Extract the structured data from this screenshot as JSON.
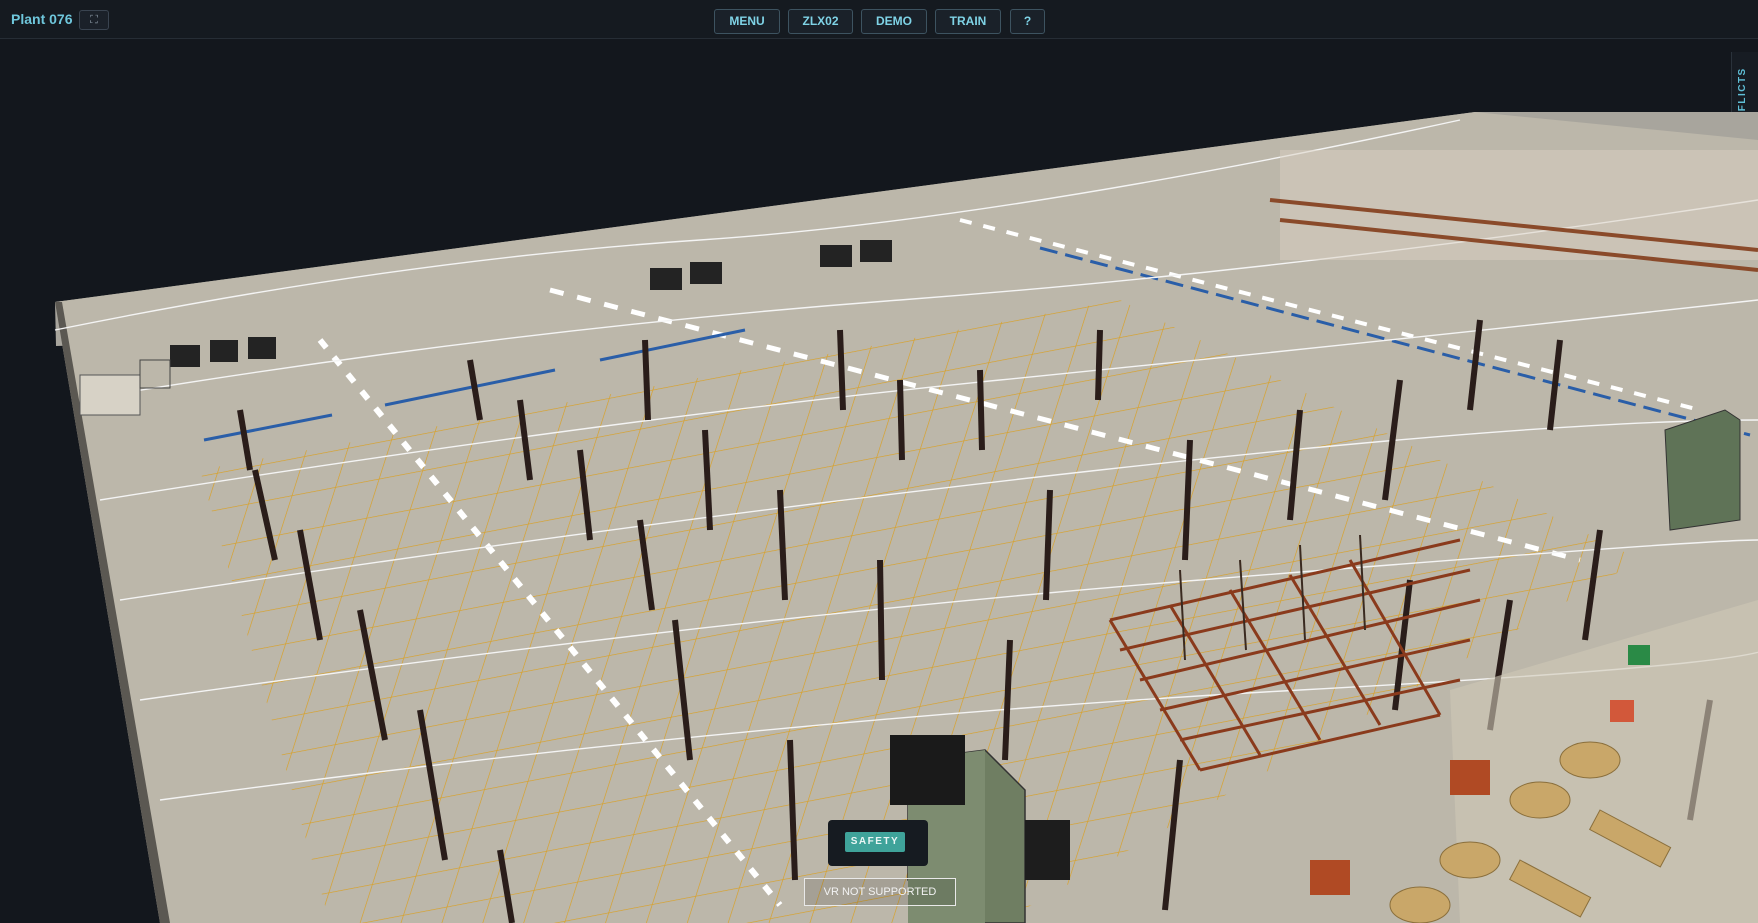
{
  "header": {
    "title": "Plant 076",
    "fullscreen_icon": "fullscreen-icon",
    "nav": [
      {
        "label": "MENU"
      },
      {
        "label": "ZLX02"
      },
      {
        "label": "DEMO"
      },
      {
        "label": "TRAIN"
      },
      {
        "label": "?"
      }
    ]
  },
  "side_panel": {
    "label": "CONFLICTS"
  },
  "scene": {
    "description_icon": "3d-warehouse-viewport"
  },
  "safety": {
    "label": "SAFETY"
  },
  "vr": {
    "label": "VR NOT SUPPORTED"
  },
  "colors": {
    "accent": "#6fc7dc",
    "floor": "#bcb7aa",
    "floor_lines": "#e3a81c",
    "columns": "#2a1d1a",
    "safety_button": "#3fa39a"
  }
}
